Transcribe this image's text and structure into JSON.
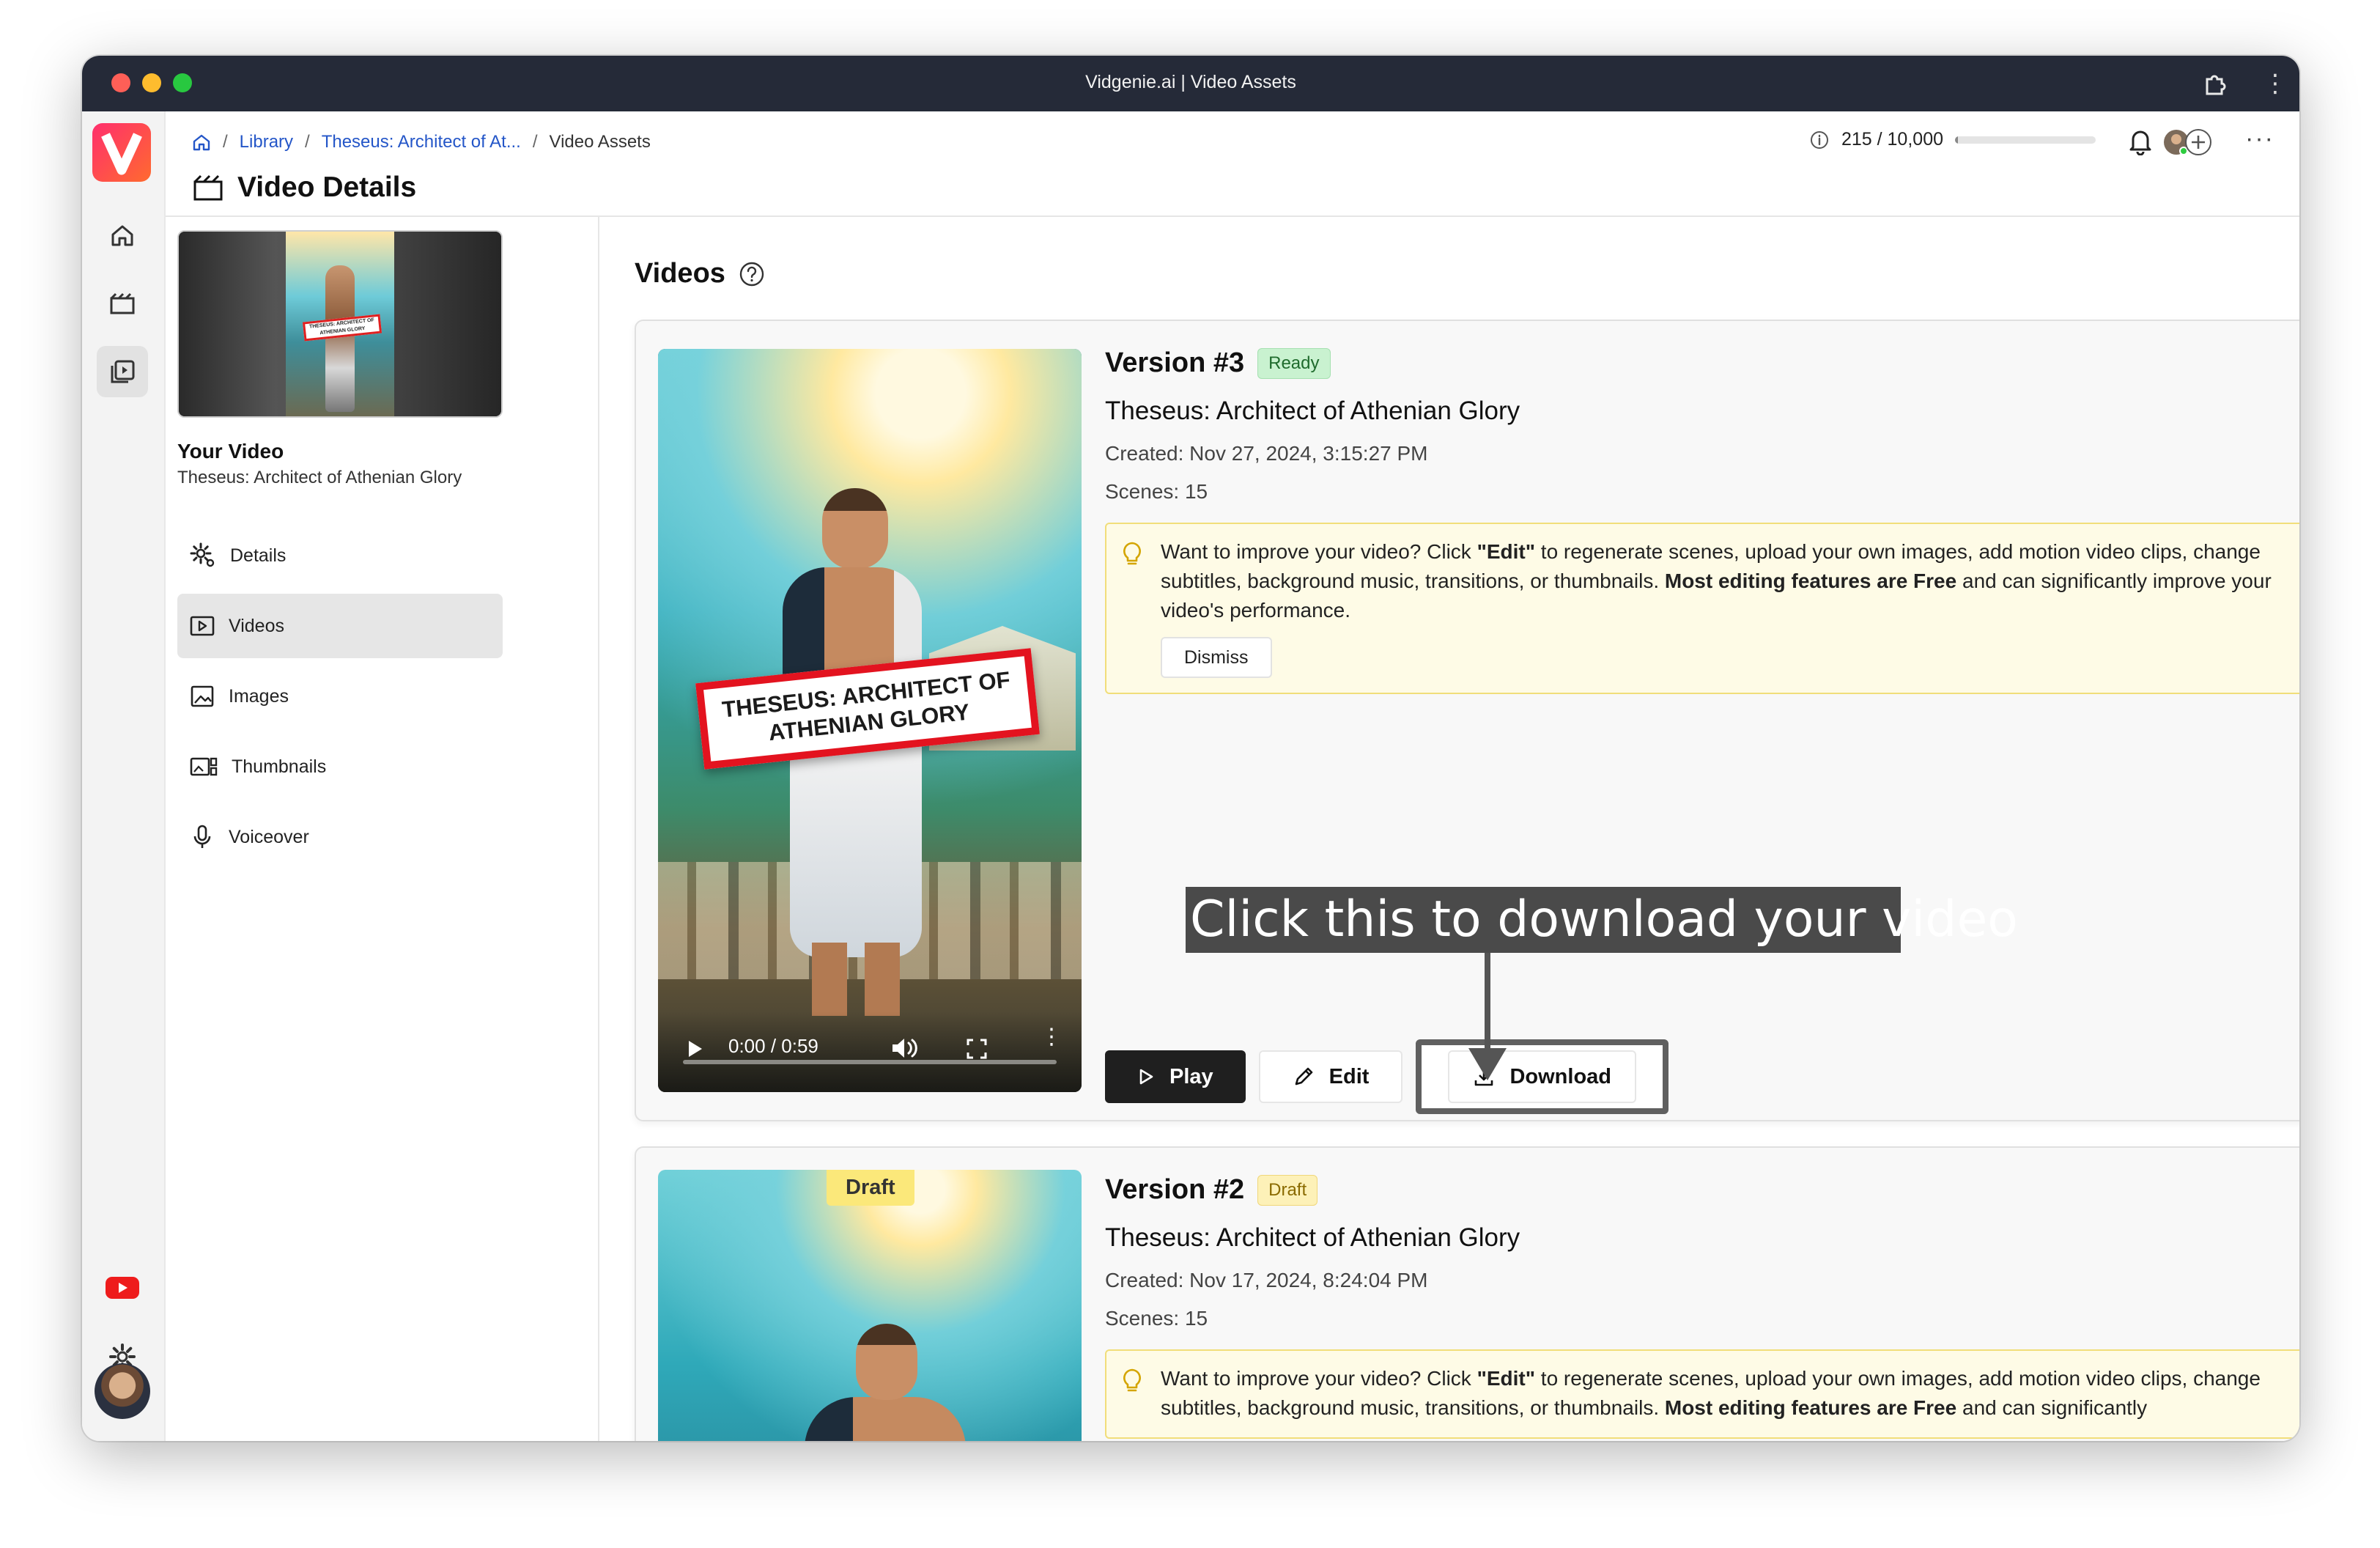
{
  "window": {
    "title": "Vidgenie.ai | Video Assets"
  },
  "header": {
    "breadcrumbs": [
      "Library",
      "Theseus: Architect of At...",
      "Video Assets"
    ],
    "page_title": "Video Details",
    "credits": {
      "used": "215",
      "total": "10,000",
      "text": "215 / 10,000",
      "fraction": 0.0215
    }
  },
  "sidebar": {
    "your_video_label": "Your Video",
    "video_name": "Theseus: Architect of Athenian Glory",
    "thumb_sign": "THESEUS: ARCHITECT OF ATHENIAN GLORY",
    "items": [
      {
        "label": "Details",
        "icon": "gear-cog-icon"
      },
      {
        "label": "Videos",
        "icon": "play-square-icon",
        "active": true
      },
      {
        "label": "Images",
        "icon": "image-icon"
      },
      {
        "label": "Thumbnails",
        "icon": "thumbnails-icon"
      },
      {
        "label": "Voiceover",
        "icon": "microphone-icon"
      }
    ]
  },
  "main": {
    "section_title": "Videos",
    "versions": [
      {
        "title": "Version #3",
        "status": "Ready",
        "name": "Theseus: Architect of Athenian Glory",
        "created": "Created: Nov 27, 2024, 3:15:27 PM",
        "scenes": "Scenes: 15",
        "player": {
          "sign_text": "THESEUS: ARCHITECT OF ATHENIAN GLORY",
          "time": "0:00 / 0:59"
        },
        "tip": {
          "part1": "Want to improve your video? Click ",
          "edit_word": "\"Edit\"",
          "part2": " to regenerate scenes, upload your own images, add motion video clips, change subtitles, background music, transitions, or thumbnails. ",
          "bold": "Most editing features are Free",
          "part3": " and can significantly improve your video's performance.",
          "dismiss": "Dismiss"
        },
        "actions": {
          "play": "Play",
          "edit": "Edit",
          "download": "Download"
        }
      },
      {
        "title": "Version #2",
        "status": "Draft",
        "overlay_tag": "Draft",
        "name": "Theseus: Architect of Athenian Glory",
        "created": "Created: Nov 17, 2024, 8:24:04 PM",
        "scenes": "Scenes: 15",
        "tip": {
          "part1": "Want to improve your video? Click ",
          "edit_word": "\"Edit\"",
          "part2": " to regenerate scenes, upload your own images, add motion video clips, change subtitles, background music, transitions, or thumbnails. ",
          "bold": "Most editing features are Free",
          "part3": " and can significantly"
        }
      }
    ]
  },
  "annotation": {
    "callout": "Click this to download your video"
  },
  "colors": {
    "titlebar": "#252a38",
    "logo_start": "#ff2f6d",
    "logo_end": "#ff6a2f",
    "ready_badge": "#c9f2d0",
    "draft_badge": "#fdf1b8",
    "sign_border": "#e3131f"
  }
}
